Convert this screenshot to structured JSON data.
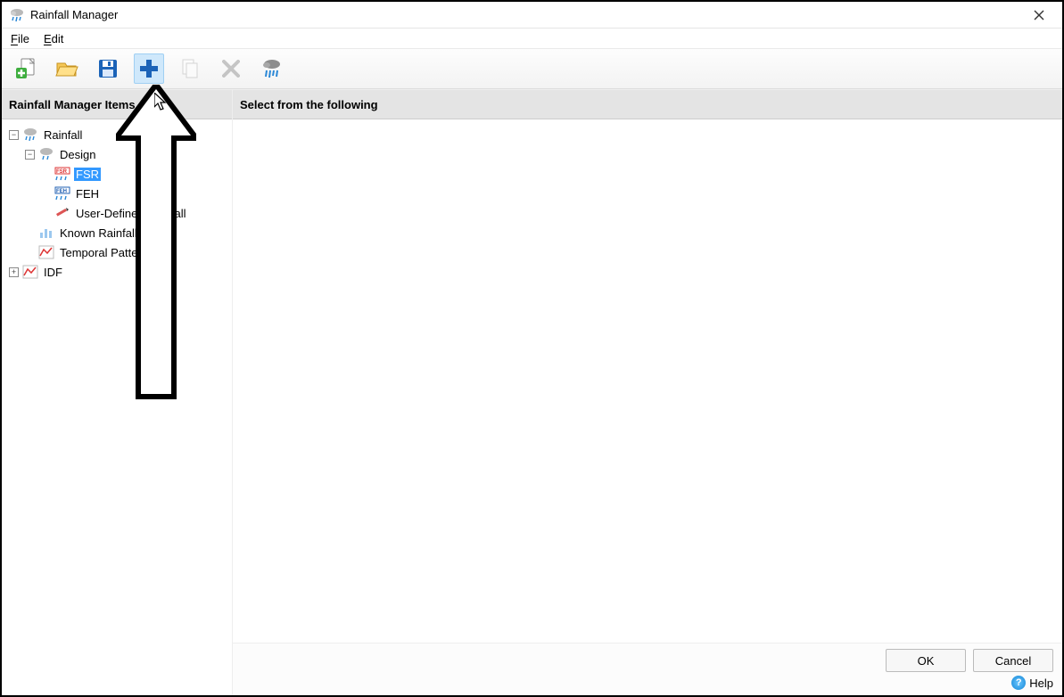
{
  "window": {
    "title": "Rainfall Manager"
  },
  "menubar": {
    "file": {
      "label": "File",
      "mnemonic": "F"
    },
    "edit": {
      "label": "Edit",
      "mnemonic": "E"
    }
  },
  "toolbar": {
    "new_doc": "New",
    "open": "Open",
    "save": "Save",
    "add": "Add",
    "copy": "Copy",
    "delete": "Delete",
    "rainfall": "Rainfall"
  },
  "sidebar": {
    "header": "Rainfall Manager Items",
    "tree": {
      "root": {
        "label": "Rainfall",
        "expanded": true
      },
      "design": {
        "label": "Design",
        "expanded": true
      },
      "fsr": {
        "label": "FSR",
        "selected": true
      },
      "feh": {
        "label": "FEH"
      },
      "user_defined": {
        "label": "User-Defined Rainfall"
      },
      "known": {
        "label": "Known Rainfall"
      },
      "temporal": {
        "label": "Temporal Patterns"
      },
      "idf": {
        "label": "IDF",
        "expanded": false
      }
    }
  },
  "main": {
    "header": "Select from the following"
  },
  "footer": {
    "ok": "OK",
    "cancel": "Cancel",
    "help": "Help"
  }
}
